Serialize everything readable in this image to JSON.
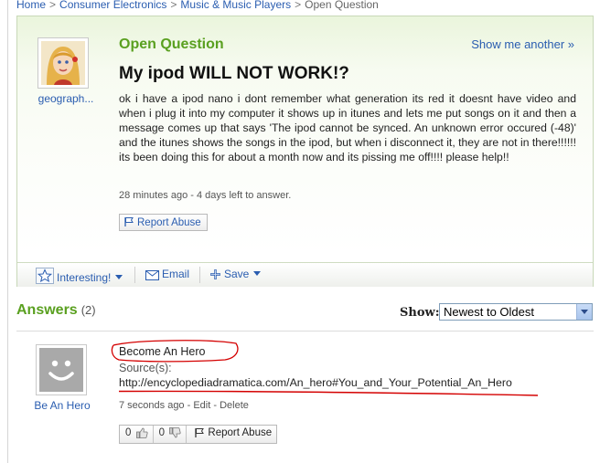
{
  "breadcrumb": {
    "items": [
      "Home",
      "Consumer Electronics",
      "Music & Music Players",
      "Open Question"
    ],
    "separator": ">"
  },
  "question": {
    "status": "Open Question",
    "show_another": "Show me another »",
    "asker": "geograph...",
    "title": "My ipod WILL NOT WORK!?",
    "body": "ok i have a ipod nano i dont remember what generation its red it doesnt have video and when i plug it into my computer it shows up in itunes and lets me put songs on it and then a message comes up that says 'The ipod cannot be synced. An unknown error occured (-48)' and the itunes shows the songs in the ipod, but when i disconnect it, they are not in there!!!!!! its been doing this for about a month now and its pissing me off!!!! please help!!",
    "meta": "28 minutes ago - 4 days left to answer.",
    "report_abuse": "Report Abuse"
  },
  "toolbar": {
    "interesting": "Interesting!",
    "email": "Email",
    "save": "Save"
  },
  "answers": {
    "heading": "Answers",
    "count": "(2)",
    "show_label": "Show:",
    "sort_selected": "Newest to Oldest"
  },
  "answer": {
    "author": "Be An Hero",
    "text": "Become An Hero",
    "source_label": "Source(s):",
    "source_url": "http://encyclopediadramatica.com/An_hero#You_and_Your_Potential_An_Hero",
    "time": "7 seconds ago",
    "edit": "Edit",
    "delete": "Delete",
    "thumbs_up": "0",
    "thumbs_down": "0",
    "report_abuse": "Report Abuse"
  },
  "colors": {
    "accent_green": "#5aa020",
    "link_blue": "#2a5db0",
    "annotation_red": "#d40000"
  },
  "icons": [
    "user-avatar",
    "star-icon",
    "envelope-icon",
    "plus-icon",
    "flag-icon",
    "thumbs-up-icon",
    "thumbs-down-icon"
  ]
}
